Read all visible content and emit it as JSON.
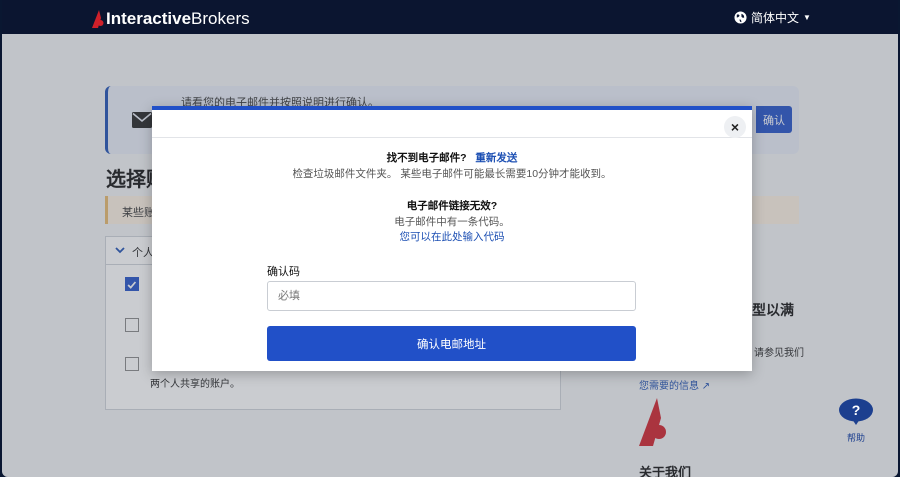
{
  "nav": {
    "brand_bold": "Interactive",
    "brand_regular": "Brokers",
    "language": "简体中文"
  },
  "background": {
    "email_banner_text": "请看您的电子邮件并按照说明进行确认。",
    "email_banner_button": "确认",
    "heading_partial": "选择账",
    "warning_partial": "某些账",
    "panel_header": "个人",
    "panel_description": "两个人共享的账户。",
    "side_title_partial": "型以满",
    "side_text_partial": "请参见我们",
    "side_link": "您需要的信息",
    "about_heading": "关于我们"
  },
  "modal": {
    "not_found_q": "找不到电子邮件?",
    "resend_link": "重新发送",
    "spam_hint": "检查垃圾邮件文件夹。 某些电子邮件可能最长需要10分钟才能收到。",
    "invalid_link_q": "电子邮件链接无效?",
    "code_hint": "电子邮件中有一条代码。",
    "enter_code_link": "您可以在此处输入代码",
    "code_label": "确认码",
    "code_placeholder": "必填",
    "code_value": "",
    "submit_label": "确认电邮地址",
    "close_symbol": "×"
  },
  "help": {
    "label": "帮助",
    "symbol": "?"
  },
  "colors": {
    "nav_bg": "#0b1530",
    "primary": "#2150c8",
    "link": "#1c4fb3",
    "brand_red": "#d0202a"
  }
}
